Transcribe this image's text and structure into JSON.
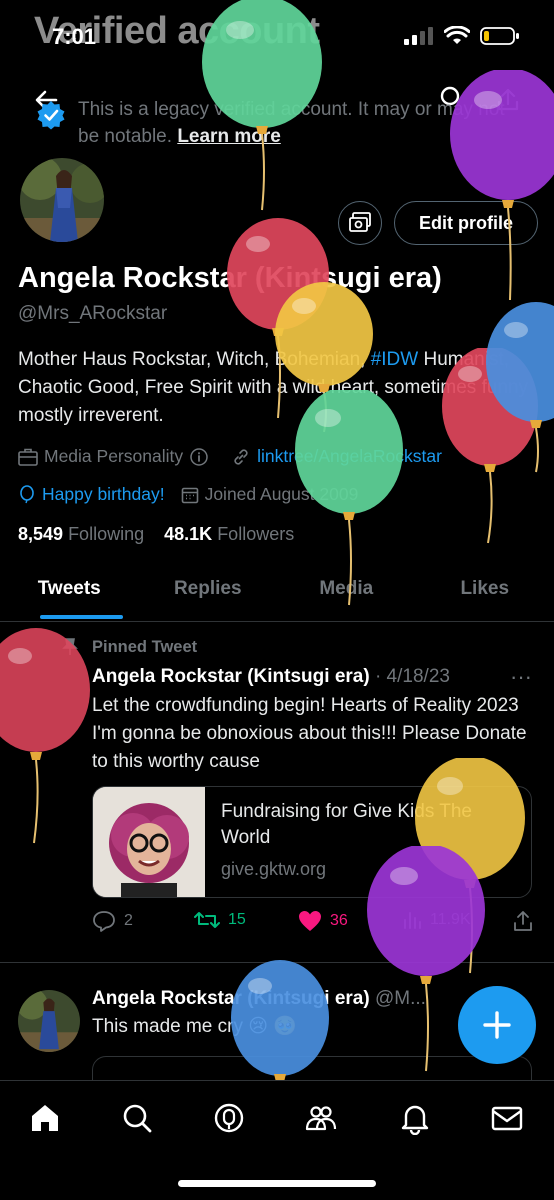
{
  "status": {
    "time": "7:01"
  },
  "overlay_title": "Verified account",
  "verified_notice": {
    "text": "This is a legacy verified account. It may or may not be notable.",
    "link": "Learn more"
  },
  "profile": {
    "edit_label": "Edit profile",
    "display_name": "Angela Rockstar (Kintsugi era)",
    "handle": "@Mrs_ARockstar",
    "bio_pre": "Mother Haus Rockstar, Witch, Bohemian, ",
    "bio_hashtag": "#IDW",
    "bio_post": " Humanist, Chaotic Good, Free Spirit with a wild heart, sometimes funny mostly irreverent.",
    "category": "Media Personality",
    "link": "linktree/AngelaRockstar",
    "birthday": "Happy birthday!",
    "joined": "Joined August 2009",
    "following_count": "8,549",
    "following_label": "Following",
    "followers_count": "48.1K",
    "followers_label": "Followers"
  },
  "tabs": [
    {
      "label": "Tweets"
    },
    {
      "label": "Replies"
    },
    {
      "label": "Media"
    },
    {
      "label": "Likes"
    }
  ],
  "pinned_tweet": {
    "pinned_label": "Pinned Tweet",
    "author": "Angela Rockstar (Kintsugi era)",
    "date": "· 4/18/23",
    "text": "Let the crowdfunding begin! Hearts of Reality 2023 I'm gonna be obnoxious about this!!! Please Donate to this worthy cause",
    "card_title": "Fundraising for Give Kids The World",
    "card_domain": "give.gktw.org",
    "replies": "2",
    "retweets": "15",
    "likes": "36",
    "views": "11.9K"
  },
  "second_tweet": {
    "author": "Angela Rockstar (Kintsugi era)",
    "handle": "@M...",
    "text": "This made me cry 😢 🥹"
  },
  "colors": {
    "accent": "#1d9bf0",
    "like": "#f91880",
    "retweet": "#00ba7c"
  }
}
